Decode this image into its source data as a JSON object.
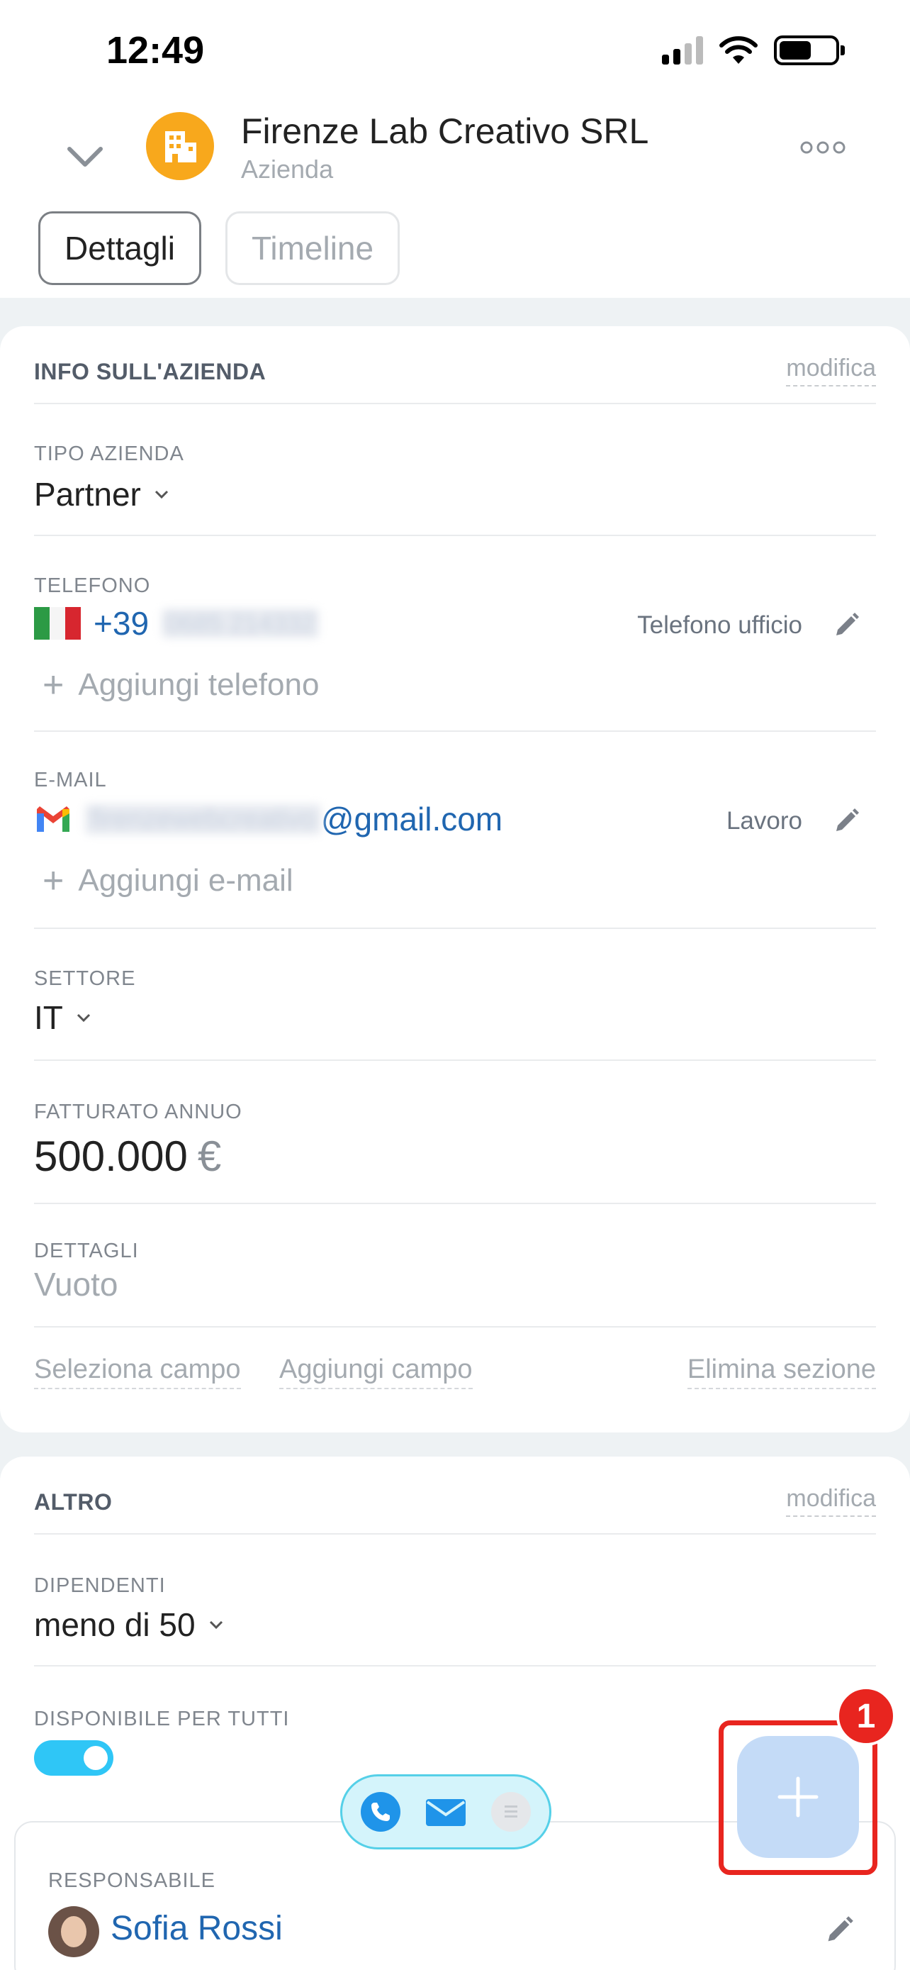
{
  "status_bar": {
    "time": "12:49"
  },
  "header": {
    "company_name": "Firenze Lab Creativo SRL",
    "company_type": "Azienda",
    "tabs": [
      {
        "label": "Dettagli",
        "active": true
      },
      {
        "label": "Timeline",
        "active": false
      }
    ]
  },
  "info_section": {
    "title": "INFO SULL'AZIENDA",
    "edit_label": "modifica",
    "company_type_field": {
      "label": "TIPO AZIENDA",
      "value": "Partner"
    },
    "phone_field": {
      "label": "TELEFONO",
      "prefix": "+39",
      "number_hidden": "0685 214332",
      "type": "Telefono ufficio",
      "add_label": "Aggiungi telefono"
    },
    "email_field": {
      "label": "E-MAIL",
      "local_hidden": "firenzewebcreativo",
      "domain": "@gmail.com",
      "type": "Lavoro",
      "add_label": "Aggiungi e-mail"
    },
    "industry_field": {
      "label": "SETTORE",
      "value": "IT"
    },
    "revenue_field": {
      "label": "FATTURATO ANNUO",
      "value": "500.000",
      "currency": "€"
    },
    "details_field": {
      "label": "DETTAGLI",
      "value": "Vuoto"
    },
    "footer": {
      "select_field": "Seleziona campo",
      "add_field": "Aggiungi campo",
      "delete_section": "Elimina sezione"
    }
  },
  "other_section": {
    "title": "ALTRO",
    "edit_label": "modifica",
    "employees_field": {
      "label": "DIPENDENTI",
      "value": "meno di 50"
    },
    "available_field": {
      "label": "DISPONIBILE PER TUTTI",
      "enabled": true
    }
  },
  "responsible": {
    "label": "RESPONSABILE",
    "name": "Sofia Rossi"
  },
  "fab": {
    "badge": "1"
  },
  "colors": {
    "accent_blue": "#2066b0",
    "toggle": "#2fc6f6",
    "highlight": "#e8251f",
    "avatar_orange": "#f8a81c"
  },
  "icons": [
    "chevron-down-icon",
    "building-icon",
    "more-icon",
    "pencil-icon",
    "plus-icon",
    "phone-icon",
    "mail-icon",
    "chat-icon",
    "italy-flag-icon",
    "gmail-icon"
  ]
}
